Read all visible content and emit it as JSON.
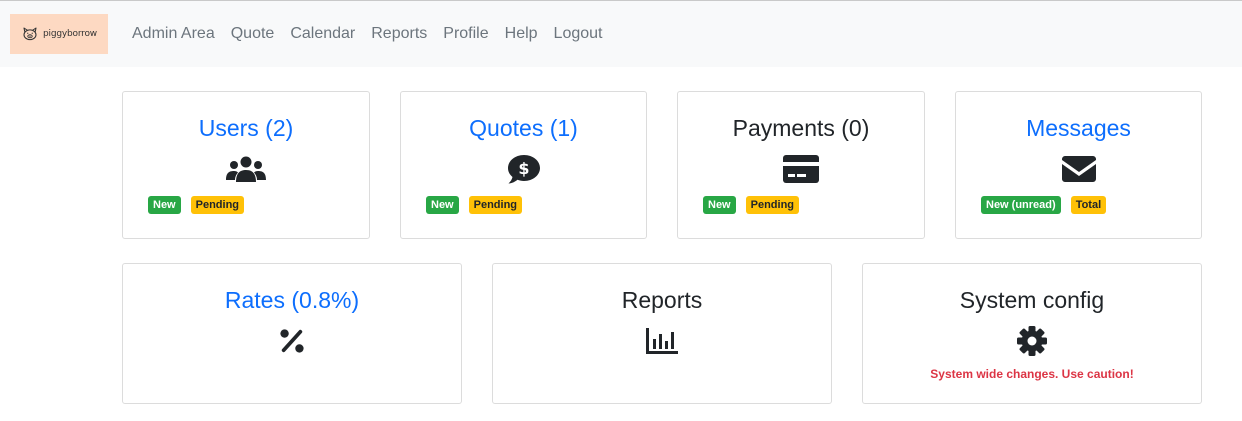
{
  "brand": {
    "name": "piggyborrow",
    "icon": "pig-icon"
  },
  "nav": [
    "Admin Area",
    "Quote",
    "Calendar",
    "Reports",
    "Profile",
    "Help",
    "Logout"
  ],
  "cards": {
    "users": {
      "title": "Users (2)",
      "icon": "users-icon",
      "badges": [
        "New",
        "Pending"
      ]
    },
    "quotes": {
      "title": "Quotes (1)",
      "icon": "dollar-comment-icon",
      "badges": [
        "New",
        "Pending"
      ]
    },
    "payments": {
      "title": "Payments (0)",
      "icon": "credit-card-icon",
      "badges": [
        "New",
        "Pending"
      ]
    },
    "messages": {
      "title": "Messages",
      "icon": "envelope-icon",
      "badges": [
        "New (unread)",
        "Total"
      ]
    },
    "rates": {
      "title": "Rates (0.8%)",
      "icon": "percent-icon"
    },
    "reports": {
      "title": "Reports",
      "icon": "bar-chart-icon"
    },
    "system": {
      "title": "System config",
      "icon": "gear-icon",
      "warning": "System wide changes. Use caution!"
    }
  },
  "colors": {
    "link": "#0d6efd",
    "success": "#28a745",
    "warning": "#ffc107",
    "danger": "#dc3545",
    "brand_bg": "#fdd9c2"
  }
}
